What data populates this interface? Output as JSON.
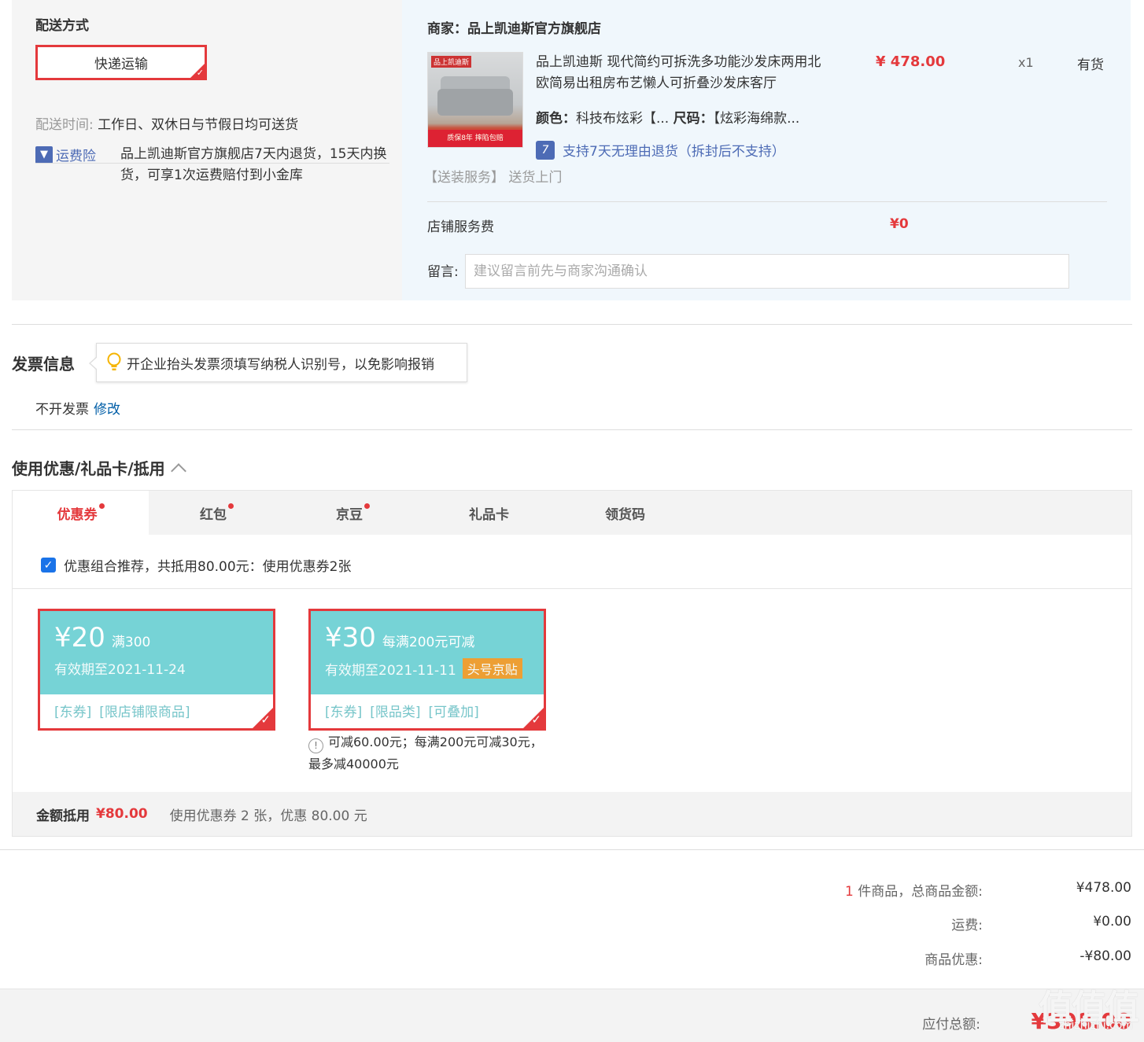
{
  "shipping": {
    "heading": "配送方式",
    "method": "快递运输",
    "time_label": "配送时间:",
    "time_value": "工作日、双休日与节假日均可送货",
    "insurance_badge": "运费险",
    "insurance_desc": "品上凯迪斯官方旗舰店7天内退货，15天内换货，可享1次运费赔付到小金库"
  },
  "merchant": {
    "name": "商家：品上凯迪斯官方旗舰店",
    "product_title": "品上凯迪斯 现代简约可拆洗多功能沙发床两用北欧简易出租房布艺懒人可折叠沙发床客厅",
    "product_image_tag": "品上凯迪斯",
    "product_image_band": "质保8年 摔陷包赔",
    "price": "¥ 478.00",
    "qty": "x1",
    "stock": "有货",
    "color_label": "颜色：",
    "color_value": "科技布炫彩【...",
    "size_label": "尺码：",
    "size_value": "【炫彩海绵款...",
    "return_policy": "支持7天无理由退货（拆封后不支持）",
    "pack_service": "【送装服务】 送货上门",
    "service_fee_label": "店铺服务费",
    "service_fee_value": "¥0",
    "message_label": "留言:",
    "message_placeholder": "建议留言前先与商家沟通确认"
  },
  "invoice": {
    "title": "发票信息",
    "tip": "开企业抬头发票须填写纳税人识别号，以免影响报销",
    "status": "不开发票",
    "modify": "修改"
  },
  "coupons": {
    "title": "使用优惠/礼品卡/抵用",
    "tabs": [
      {
        "label": "优惠券",
        "dot": true
      },
      {
        "label": "红包",
        "dot": true
      },
      {
        "label": "京豆",
        "dot": true
      },
      {
        "label": "礼品卡",
        "dot": false
      },
      {
        "label": "领货码",
        "dot": false
      }
    ],
    "recommend": "优惠组合推荐，共抵用80.00元：使用优惠券2张",
    "items": [
      {
        "amount": "¥20",
        "condition": "满300",
        "expiry": "有效期至2021-11-24",
        "tag": "",
        "labels": [
          "[东券]",
          "[限店铺限商品]"
        ]
      },
      {
        "amount": "¥30",
        "condition": "每满200元可减",
        "expiry": "有效期至2021-11-11",
        "tag": "头号京贴",
        "labels": [
          "[东券]",
          "[限品类]",
          "[可叠加]"
        ]
      }
    ],
    "note": "可减60.00元；每满200元可减30元，最多减40000元",
    "footer_label": "金额抵用",
    "footer_amount": "¥80.00",
    "footer_desc": "使用优惠券 2 张，优惠 80.00 元"
  },
  "summary": {
    "count": "1",
    "goods_label": "件商品，总商品金额:",
    "goods_value": "¥478.00",
    "freight_label": "运费:",
    "freight_value": "¥0.00",
    "discount_label": "商品优惠:",
    "discount_value": "-¥80.00",
    "total_label": "应付总额:",
    "total_value": "¥398.00",
    "watermark": "值值值",
    "watermark_sub": "zhizhizhi.com"
  },
  "colors": {
    "accent": "#e4393c",
    "coupon": "#76d3d6",
    "link": "#4d6bb5"
  }
}
